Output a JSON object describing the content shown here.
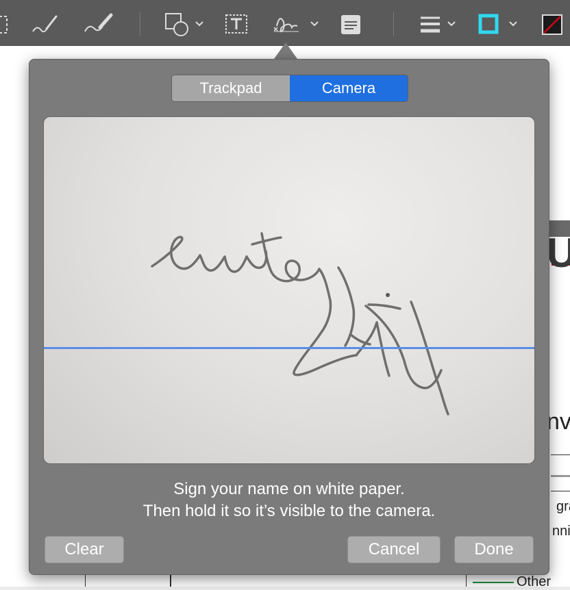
{
  "toolbar": {
    "tools": [
      {
        "name": "selection-icon"
      },
      {
        "name": "sketch-icon"
      },
      {
        "name": "draw-icon"
      },
      {
        "name": "shapes-icon"
      },
      {
        "name": "text-box-icon"
      },
      {
        "name": "signature-icon"
      },
      {
        "name": "note-icon"
      },
      {
        "name": "line-style-icon"
      },
      {
        "name": "border-color-icon",
        "color": "#2fd9f0"
      },
      {
        "name": "fill-color-icon",
        "color": "#d0021b"
      }
    ]
  },
  "document": {
    "fragments": [
      "U",
      "nv",
      "gra",
      "nnic",
      "Other"
    ]
  },
  "signature_popover": {
    "tabs": [
      {
        "label": "Trackpad",
        "selected": false
      },
      {
        "label": "Camera",
        "selected": true
      }
    ],
    "instructions_line1": "Sign your name on white paper.",
    "instructions_line2": "Then hold it so it’s visible to the camera.",
    "clear_label": "Clear",
    "cancel_label": "Cancel",
    "done_label": "Done"
  },
  "colors": {
    "accent": "#1f6fe0",
    "guide_line": "#5a8ce8",
    "popover_bg": "#7b7b7b"
  }
}
